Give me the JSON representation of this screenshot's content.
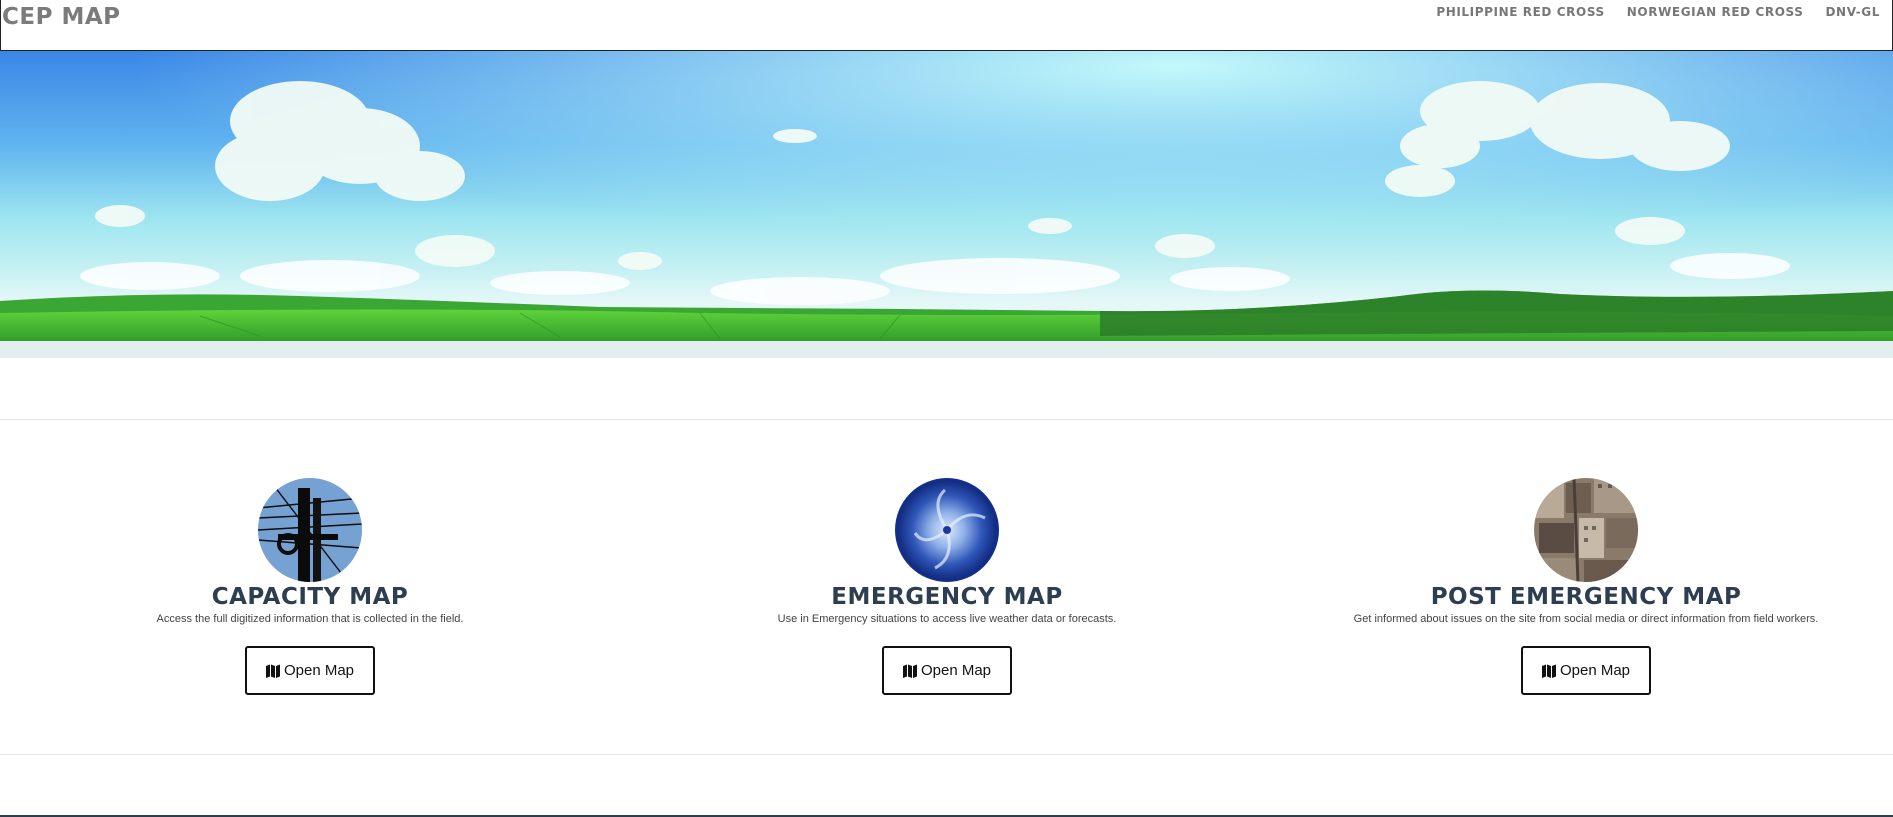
{
  "navbar": {
    "brand": "CEP MAP",
    "links": [
      {
        "label": "PHILIPPINE RED CROSS"
      },
      {
        "label": "NORWEGIAN RED CROSS"
      },
      {
        "label": "DNV-GL"
      }
    ]
  },
  "hero": {
    "icon": "landscape-sky-image"
  },
  "cards": [
    {
      "title": "CAPACITY MAP",
      "description": "Access the full digitized information that is collected in the field.",
      "button_label": "Open Map",
      "button_icon": "map-icon",
      "image": "power-pole-thumbnail"
    },
    {
      "title": "EMERGENCY MAP",
      "description": "Use in Emergency situations to access live weather data or forecasts.",
      "button_label": "Open Map",
      "button_icon": "map-icon",
      "image": "typhoon-satellite-thumbnail"
    },
    {
      "title": "POST EMERGENCY MAP",
      "description": "Get informed about issues on the site from social media or direct information from field workers.",
      "button_label": "Open Map",
      "button_icon": "map-icon",
      "image": "damaged-city-thumbnail"
    }
  ],
  "colors": {
    "heading": "#2c3e50",
    "brand": "#7b7b7b",
    "nav_link": "#777777",
    "button_border": "#111111"
  }
}
